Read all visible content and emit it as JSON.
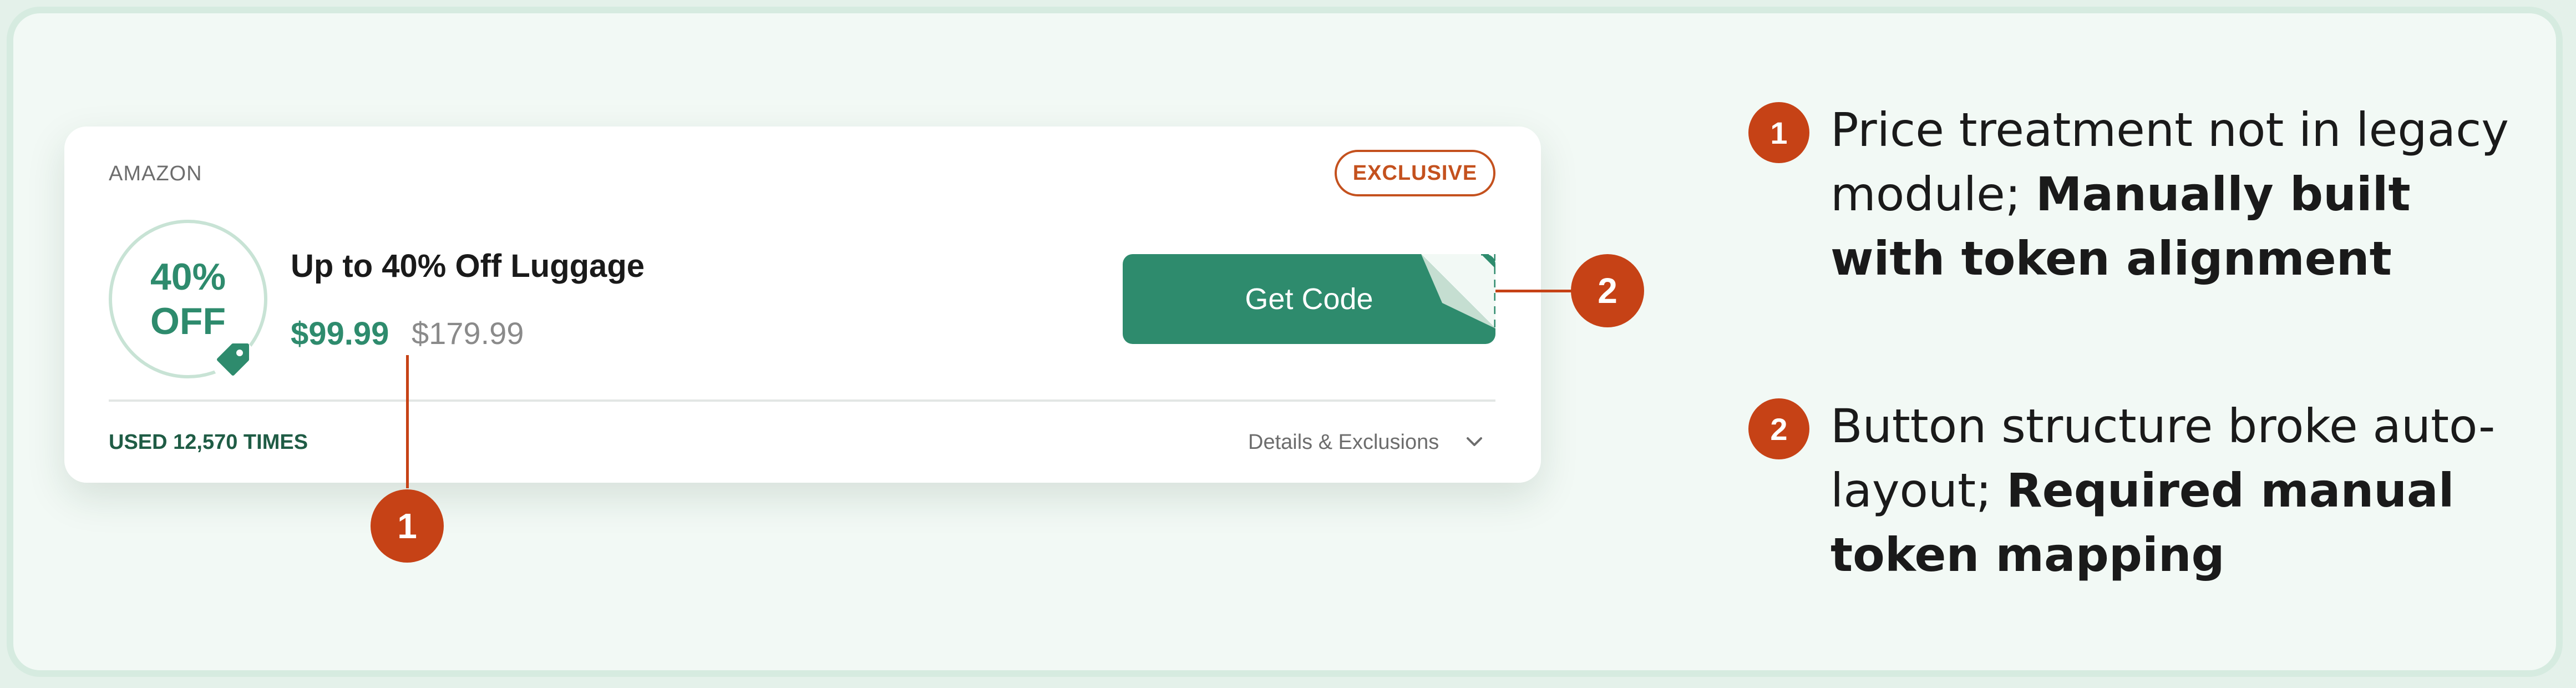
{
  "card": {
    "merchant": "AMAZON",
    "badge": "EXCLUSIVE",
    "discount": {
      "value": "40%",
      "unit": "OFF",
      "icon": "tag-icon"
    },
    "title": "Up to 40% Off Luggage",
    "price": "$99.99",
    "original_price": "$179.99",
    "button_label": "Get Code",
    "usage": "USED 12,570 TIMES",
    "details_label": "Details & Exclusions",
    "details_icon": "chevron-down-icon"
  },
  "callouts": [
    {
      "number": "1"
    },
    {
      "number": "2"
    }
  ],
  "notes": [
    {
      "number": "1",
      "text": "Price treatment not in legacy module;",
      "emphasis": "Manually built with token alignment"
    },
    {
      "number": "2",
      "text": "Button structure broke auto-layout;",
      "emphasis": "Required manual token mapping"
    }
  ],
  "colors": {
    "brand_green": "#2e8b6d",
    "accent_orange": "#c64216",
    "badge_orange": "#c4511e",
    "frame_background": "#f2f9f5",
    "frame_border": "#d6ebe0"
  }
}
